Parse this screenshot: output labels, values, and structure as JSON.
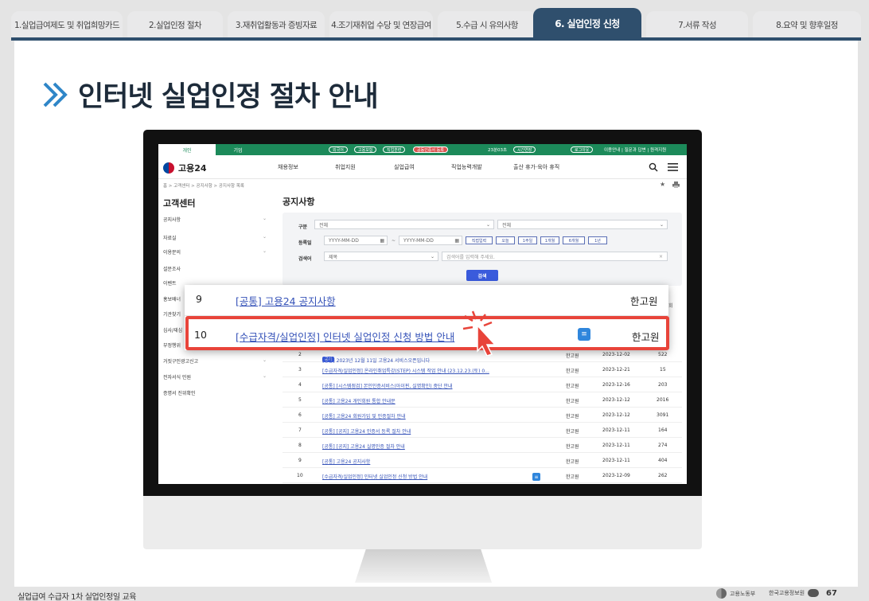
{
  "tabs": [
    {
      "label": "1.실업급여제도 및 취업희망카드",
      "active": false
    },
    {
      "label": "2.실업인정 절차",
      "active": false
    },
    {
      "label": "3.재취업활동과 증빙자료",
      "active": false
    },
    {
      "label": "4.조기재취업 수당 및 연장급여",
      "active": false
    },
    {
      "label": "5.수급 시 유의사항",
      "active": false
    },
    {
      "label": "6. 실업인정 신청",
      "active": true
    },
    {
      "label": "7.서류 작성",
      "active": false
    },
    {
      "label": "8.요약 및 향후일정",
      "active": false
    }
  ],
  "heading": "인터넷 실업인정 절차 안내",
  "site": {
    "topbar": {
      "tab_personal": "개인",
      "tab_company": "기업",
      "chips": [
        "외국어",
        "고용보험",
        "직업훈련",
        "공동인증서 등록"
      ],
      "session": "23분03초",
      "extend": "시간연장",
      "logout": "로그아웃",
      "links": "이용안내 | 질문과 답변 | 원격지원"
    },
    "logo": "고용24",
    "nav": [
      "채용정보",
      "취업지원",
      "실업급여",
      "직업능력개발",
      "출산 휴가·육아 휴직"
    ],
    "breadcrumb": "홈  >  고객센터  >  공지사항  >  공지사항 목록",
    "sidebar_title": "고객센터",
    "sidebar_items": [
      {
        "label": "공지사항",
        "dropdown": true
      },
      {
        "label": "자료실",
        "dropdown": true
      },
      {
        "label": "이용문의",
        "dropdown": true
      },
      {
        "label": "설문조사",
        "dropdown": false
      },
      {
        "label": "이벤트",
        "dropdown": false
      },
      {
        "label": "홍보배너",
        "dropdown": false
      },
      {
        "label": "기관찾기",
        "dropdown": false
      },
      {
        "label": "심사/재심",
        "dropdown": false
      },
      {
        "label": "부정행위",
        "dropdown": false
      },
      {
        "label": "거짓구인광고신고",
        "dropdown": true
      },
      {
        "label": "전자서식 민원",
        "dropdown": true
      },
      {
        "label": "증명서 진위확인",
        "dropdown": false
      }
    ],
    "content_title": "공지사항",
    "filter": {
      "category_label": "구분",
      "category_value": "전체",
      "category_value2": "전체",
      "date_label": "등록일",
      "date_from": "YYYY-MM-DD",
      "date_to": "YYYY-MM-DD",
      "date_sep": "~",
      "period_buttons": [
        "직접입력",
        "오늘",
        "1주일",
        "1개월",
        "6개월",
        "1년"
      ],
      "search_label": "검색어",
      "search_type": "제목",
      "search_placeholder": "검색어를 입력해 주세요.",
      "search_button": "검색"
    },
    "table_rows": [
      {
        "no": "2",
        "pinned": true,
        "pin_label": "공지",
        "title": "[공통] 2023년 12월 11일 고용24 서비스오픈입니다",
        "author": "한고원",
        "date": "2023-12-02",
        "views": "522",
        "attach": false
      },
      {
        "no": "3",
        "pinned": false,
        "title": "[수급자격/실업인정] 온라인취업특강(STEP) 시스템 작업 안내 (23.12.23.(토) 0...",
        "author": "한고원",
        "date": "2023-12-21",
        "views": "15",
        "attach": false
      },
      {
        "no": "4",
        "pinned": false,
        "title": "[공통] [시스템점검] 본인인증서비스(아이핀, 실명확인) 중단 안내",
        "author": "한고원",
        "date": "2023-12-16",
        "views": "203",
        "attach": false
      },
      {
        "no": "5",
        "pinned": false,
        "title": "[공통] 고용24 개인회원 통합 안내문",
        "author": "한고원",
        "date": "2023-12-12",
        "views": "2016",
        "attach": false
      },
      {
        "no": "6",
        "pinned": false,
        "title": "[공통] 고용24 회원가입 및 인증절차 안내",
        "author": "한고원",
        "date": "2023-12-12",
        "views": "3091",
        "attach": false
      },
      {
        "no": "7",
        "pinned": false,
        "title": "[공통] [공지] 고용24 인증서 등록 절차 안내",
        "author": "한고원",
        "date": "2023-12-11",
        "views": "164",
        "attach": false
      },
      {
        "no": "8",
        "pinned": false,
        "title": "[공통] [공지] 고용24 실명인증 절차 안내",
        "author": "한고원",
        "date": "2023-12-11",
        "views": "274",
        "attach": false
      },
      {
        "no": "9",
        "pinned": false,
        "title": "[공통] 고용24 공지사항",
        "author": "한고원",
        "date": "2023-12-11",
        "views": "404",
        "attach": false
      },
      {
        "no": "10",
        "pinned": false,
        "title": "[수급자격/실업인정] 인터넷 실업인정 신청 방법 안내",
        "author": "한고원",
        "date": "2023-12-09",
        "views": "262",
        "attach": true
      }
    ],
    "partial_header_cell": "회"
  },
  "zoom": {
    "row1": {
      "no": "9",
      "title": "[공통] 고용24 공지사항",
      "author": "한고원"
    },
    "row2": {
      "no": "10",
      "title": "[수급자격/실업인정] 인터넷 실업인정 신청 방법 안내",
      "author": "한고원"
    }
  },
  "footer": {
    "left": "실업급여 수급자 1차 실업인정일 교육",
    "logo1": "고용노동부",
    "logo2": "한국고용정보원",
    "page": "67"
  },
  "colors": {
    "tab_active": "#2f4f6d",
    "site_green": "#1c8a5a",
    "link_blue": "#3552b8",
    "highlight_red": "#e8443a",
    "search_blue": "#3a5bdc"
  }
}
